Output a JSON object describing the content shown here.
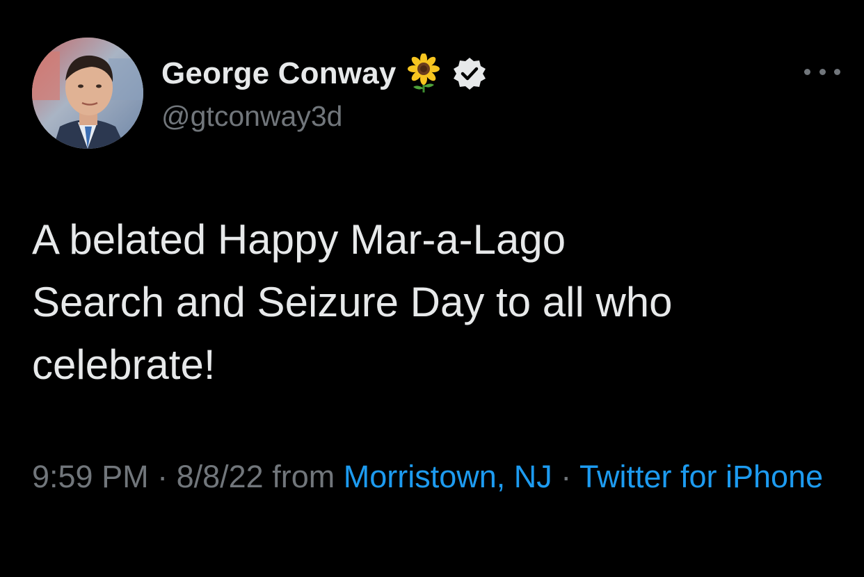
{
  "author": {
    "display_name": "George Conway",
    "emoji": "sunflower",
    "verified": true,
    "handle": "@gtconway3d"
  },
  "icons": {
    "avatar": "profile-photo",
    "sunflower": "sunflower-icon",
    "verified": "verified-badge-icon",
    "more": "more-options-icon"
  },
  "tweet": {
    "text": "A belated Happy Mar-a-Lago\nSearch and Seizure Day to all who\ncelebrate!"
  },
  "meta": {
    "time": "9:59 PM",
    "separator1": " · ",
    "date": "8/8/22",
    "from_label": " from ",
    "location": "Morristown, NJ",
    "separator2": " · ",
    "source": "Twitter for iPhone"
  },
  "colors": {
    "background": "#000000",
    "primary_text": "#e7e9ea",
    "secondary_text": "#71767b",
    "link": "#1d9bf0"
  }
}
